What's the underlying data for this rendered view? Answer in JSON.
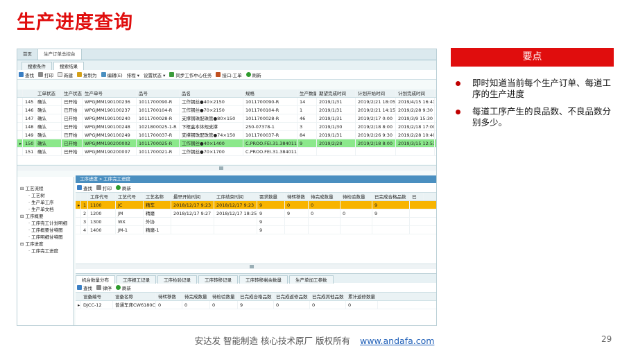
{
  "slide": {
    "title": "生产进度查询",
    "keypoints_title": "要点",
    "bullets": [
      "即时知道当前每个生产订单、每道工序的生产进度",
      "每道工序产生的良品数、不良品数分别多少。"
    ],
    "footer_text": "安达发  智能制造 核心技术原厂   版权所有",
    "footer_link": "www.andafa.com",
    "page_number": "29"
  },
  "top_tabs": [
    "首页",
    "生产订单总控台"
  ],
  "sub_tabs": [
    "搜索条件",
    "搜索结果"
  ],
  "toolbar1": [
    "查找",
    "打印",
    "新建",
    "复制为",
    "编辑(E)",
    "排程 ▾",
    "设置状态 ▾",
    "同步工作中心任务",
    "接口:工单",
    "刷新"
  ],
  "orders": {
    "headers": [
      "",
      "",
      "工单状态",
      "生产状态",
      "生产单号",
      "品号",
      "品名",
      "规格",
      "生产数量",
      "期望完成时间",
      "计划开始时间",
      "计划完成时间"
    ],
    "rows": [
      [
        "",
        "145",
        "确认",
        "已开始",
        "WPGJMM190100236",
        "1011700090-R",
        "工作钢丝●40×2150",
        "1011700090-R",
        "14",
        "2019/1/31",
        "2019/2/21 18:05",
        "2019/4/15 16:41"
      ],
      [
        "",
        "146",
        "确认",
        "已开始",
        "WPGJMM190100237",
        "1011700104-R",
        "工作钢丝●70×2150",
        "1011700104-R",
        "1",
        "2019/1/31",
        "2019/2/21 14:15",
        "2019/2/28 9:30"
      ],
      [
        "",
        "147",
        "确认",
        "已开始",
        "WPGJMM190100240",
        "1011700028-R",
        "支撑钢珠配珠管●80×150",
        "1011700028-R",
        "46",
        "2019/1/31",
        "2019/2/17 0:00",
        "2019/3/9 15:30"
      ],
      [
        "",
        "148",
        "确认",
        "已开始",
        "WPGJMM190100248",
        "1021800025-1-R",
        "下框盒本体规支撑",
        "250-07378-1",
        "3",
        "2019/1/30",
        "2019/2/18 8:00",
        "2019/2/18 17:00"
      ],
      [
        "",
        "149",
        "确认",
        "已开始",
        "WPGJMM190100249",
        "1011700037-R",
        "支撑钢珠配珠管●74×150",
        "1011700037-R",
        "84",
        "2019/1/31",
        "2019/2/26 9:30",
        "2019/2/28 10:40"
      ],
      [
        "▸",
        "150",
        "确认",
        "已开始",
        "WPGJMM190200002",
        "1011700025-R",
        "工作钢丝●40×1400",
        "C.PROO.FEI.31.384011-...",
        "9",
        "2019/2/28",
        "2019/2/18 8:00",
        "2019/3/15 12:51"
      ],
      [
        "",
        "151",
        "确认",
        "已开始",
        "WPGJMM190200007",
        "1011700021-R",
        "工作钢丝●70×1700",
        "C.PROO.FEI.31.384011-...",
        "",
        "",
        "",
        ""
      ]
    ]
  },
  "tree": {
    "items": [
      {
        "label": "工艺流程",
        "level": 0
      },
      {
        "label": "工艺树",
        "level": 1
      },
      {
        "label": "生产单工序",
        "level": 1
      },
      {
        "label": "生产单文档",
        "level": 1
      },
      {
        "label": "工序概要",
        "level": 0
      },
      {
        "label": "工序完工计划明细",
        "level": 1
      },
      {
        "label": "工序概要甘特图",
        "level": 1
      },
      {
        "label": "工序明细甘特图",
        "level": 1
      },
      {
        "label": "工序进度",
        "level": 0
      },
      {
        "label": "工序完工进度",
        "level": 1
      }
    ]
  },
  "process_panel": {
    "breadcrumb": "工序进度 » 工序完工进度",
    "toolbar": [
      "查找",
      "打印",
      "刷新"
    ],
    "headers": [
      "",
      "",
      "工序代号",
      "工艺代号",
      "工艺名称",
      "最早开始时间",
      "工序结束时间",
      "需求数量",
      "待转移数",
      "待完成数量",
      "待检验数量",
      "已完成合格品数",
      "已"
    ],
    "rows": [
      [
        "▸",
        "1",
        "1100",
        "JC",
        "精车",
        "2018/12/17 9:23",
        "2018/12/17 9:23",
        "9",
        "0",
        "0",
        "",
        "9"
      ],
      [
        "",
        "2",
        "1200",
        "JM",
        "精磨",
        "2018/12/17 9:27",
        "2018/12/17 18:25",
        "9",
        "9",
        "0",
        "0",
        "9"
      ],
      [
        "",
        "3",
        "1300",
        "WX",
        "外协",
        "",
        "",
        "9",
        "",
        "",
        "",
        ""
      ],
      [
        "",
        "4",
        "1400",
        "JM-1",
        "精磨-1",
        "",
        "",
        "9",
        "",
        "",
        "",
        ""
      ]
    ]
  },
  "bottom_tabs": [
    "机台数量分布",
    "工序报工记录",
    "工序检验记录",
    "工序转移记录",
    "工序转移剩余数量",
    "生产单加工参数"
  ],
  "bottom_toolbar": [
    "查找",
    "律停",
    "刷新"
  ],
  "machines": {
    "headers": [
      "",
      "设备编号",
      "设备名称",
      "待转移数",
      "待完成数量",
      "待检验数量",
      "已完成合格品数",
      "已完成返修品数",
      "已完成其他品数",
      "累计返修数量"
    ],
    "rows": [
      [
        "▸",
        "DJCC-12",
        "普通车床CW6180C·...",
        "0",
        "0",
        "0",
        "9",
        "0",
        "0",
        "0"
      ]
    ]
  }
}
